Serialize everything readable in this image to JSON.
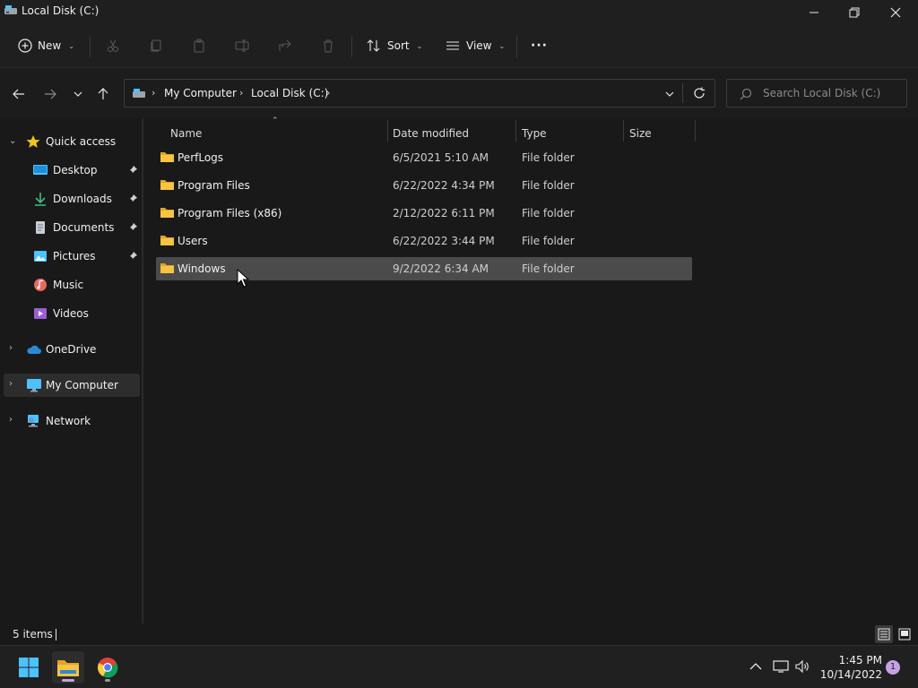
{
  "window": {
    "title": "Local Disk (C:)"
  },
  "command_bar": {
    "new_label": "New",
    "sort_label": "Sort",
    "view_label": "View",
    "more_label": "···"
  },
  "address": {
    "crumbs": [
      "My Computer",
      "Local Disk (C:)"
    ],
    "search_placeholder": "Search Local Disk (C:)"
  },
  "sidebar": {
    "quick_access": "Quick access",
    "items": [
      {
        "label": "Desktop",
        "icon": "desktop-icon",
        "pinned": true
      },
      {
        "label": "Downloads",
        "icon": "download-icon",
        "pinned": true
      },
      {
        "label": "Documents",
        "icon": "documents-icon",
        "pinned": true
      },
      {
        "label": "Pictures",
        "icon": "pictures-icon",
        "pinned": true
      },
      {
        "label": "Music",
        "icon": "music-icon",
        "pinned": false
      },
      {
        "label": "Videos",
        "icon": "videos-icon",
        "pinned": false
      }
    ],
    "onedrive": "OneDrive",
    "my_computer": "My Computer",
    "network": "Network"
  },
  "columns": {
    "name": "Name",
    "date": "Date modified",
    "type": "Type",
    "size": "Size"
  },
  "files": [
    {
      "name": "PerfLogs",
      "date": "6/5/2021 5:10 AM",
      "type": "File folder"
    },
    {
      "name": "Program Files",
      "date": "6/22/2022 4:34 PM",
      "type": "File folder"
    },
    {
      "name": "Program Files (x86)",
      "date": "2/12/2022 6:11 PM",
      "type": "File folder"
    },
    {
      "name": "Users",
      "date": "6/22/2022 3:44 PM",
      "type": "File folder"
    },
    {
      "name": "Windows",
      "date": "9/2/2022 6:34 AM",
      "type": "File folder"
    }
  ],
  "status": {
    "item_count": "5 items"
  },
  "taskbar": {
    "time": "1:45 PM",
    "date": "10/14/2022",
    "notification_count": "1"
  },
  "colors": {
    "folder": "#f6c342",
    "accent": "#4cc2ff",
    "star": "#f0c419",
    "hover_row": "#4b4b4b"
  }
}
